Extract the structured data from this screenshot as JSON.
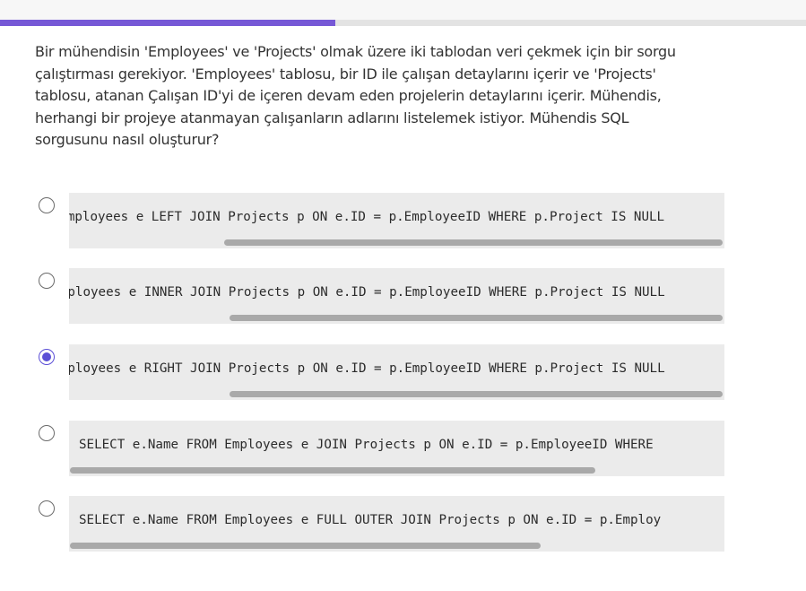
{
  "progress": {
    "percent": 41.6,
    "fill_color": "#7658d6"
  },
  "question": {
    "text": "Bir mühendisin 'Employees' ve 'Projects' olmak üzere iki tablodan veri çekmek için bir sorgu çalıştırması gerekiyor. 'Employees' tablosu, bir ID ile çalışan detaylarını içerir ve 'Projects' tablosu, atanan Çalışan ID'yi de içeren devam eden projelerin detaylarını içerir. Mühendis, herhangi bir projeye atanmayan çalışanların adlarını listelemek istiyor. Mühendis SQL sorgusunu nasıl oluşturur?"
  },
  "options": [
    {
      "code": "SELECT e.Name FROM Employees e LEFT JOIN Projects p ON e.ID = p.EmployeeID WHERE p.Project IS NULL",
      "selected": false
    },
    {
      "code": "SELECT e.Name FROM Employees e INNER JOIN Projects p ON e.ID = p.EmployeeID WHERE p.Project IS NULL",
      "selected": false
    },
    {
      "code": "SELECT e.Name FROM Employees e RIGHT JOIN Projects p ON e.ID = p.EmployeeID WHERE p.Project IS NULL",
      "selected": true
    },
    {
      "code": "SELECT e.Name FROM Employees e JOIN Projects p ON e.ID = p.EmployeeID WHERE",
      "selected": false
    },
    {
      "code": "SELECT e.Name FROM Employees e FULL OUTER JOIN Projects p ON e.ID = p.Employ",
      "selected": false
    }
  ],
  "accent_color": "#5b4fd6"
}
